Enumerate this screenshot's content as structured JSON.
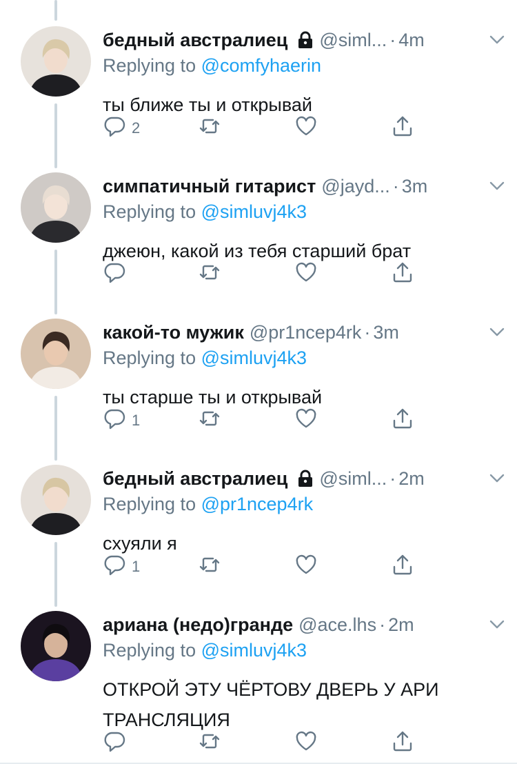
{
  "tweets": [
    {
      "name": "бедный австралиец",
      "locked": true,
      "handle": "@siml...",
      "dot": "·",
      "time": "4m",
      "replying_prefix": "Replying to ",
      "replying_to": "@comfyhaerin",
      "text_lines": [
        "ты ближе ты и открывай"
      ],
      "reply_count": "2",
      "avatar_colors": {
        "bg": "#e7e2dc",
        "hair": "#d9c9a8",
        "skin": "#f1dccd",
        "suit": "#1e1e22"
      }
    },
    {
      "name": "симпатичный гитарист",
      "locked": false,
      "handle": "@jayd...",
      "dot": "·",
      "time": "3m",
      "replying_prefix": "Replying to ",
      "replying_to": "@simluvj4k3",
      "text_lines": [
        "джеюн, какой из тебя старший брат"
      ],
      "reply_count": "",
      "avatar_colors": {
        "bg": "#cfcac6",
        "hair": "#e8ddd2",
        "skin": "#f3e3d7",
        "suit": "#2a2a2e"
      }
    },
    {
      "name": "какой-то мужик",
      "locked": false,
      "handle": "@pr1ncep4rk",
      "dot": "·",
      "time": "3m",
      "replying_prefix": "Replying to ",
      "replying_to": "@simluvj4k3",
      "text_lines": [
        "ты старше ты и открывай"
      ],
      "reply_count": "1",
      "avatar_colors": {
        "bg": "#d8c3ae",
        "hair": "#3a2a22",
        "skin": "#e9c9b0",
        "suit": "#f2ebe4"
      }
    },
    {
      "name": "бедный австралиец",
      "locked": true,
      "handle": "@siml...",
      "dot": "·",
      "time": "2m",
      "replying_prefix": "Replying to ",
      "replying_to": "@pr1ncep4rk",
      "text_lines": [
        "схуяли я"
      ],
      "reply_count": "1",
      "avatar_colors": {
        "bg": "#e6e0da",
        "hair": "#d7c6a3",
        "skin": "#f1dccd",
        "suit": "#1e1e22"
      }
    },
    {
      "name": "ариана (недо)гранде",
      "locked": false,
      "handle": "@ace.lhs",
      "dot": "·",
      "time": "2m",
      "replying_prefix": "Replying to ",
      "replying_to": "@simluvj4k3",
      "text_lines": [
        "ОТКРОЙ ЭТУ ЧЁРТОВУ ДВЕРЬ У АРИ",
        "ТРАНСЛЯЦИЯ"
      ],
      "reply_count": "",
      "avatar_colors": {
        "bg": "#1b1420",
        "hair": "#0f0c10",
        "skin": "#d6b39a",
        "suit": "#5a3fa0"
      }
    }
  ],
  "colors": {
    "name": "#14171a",
    "meta": "#657786",
    "link": "#1da1f2",
    "thread": "#ccd6dd"
  }
}
